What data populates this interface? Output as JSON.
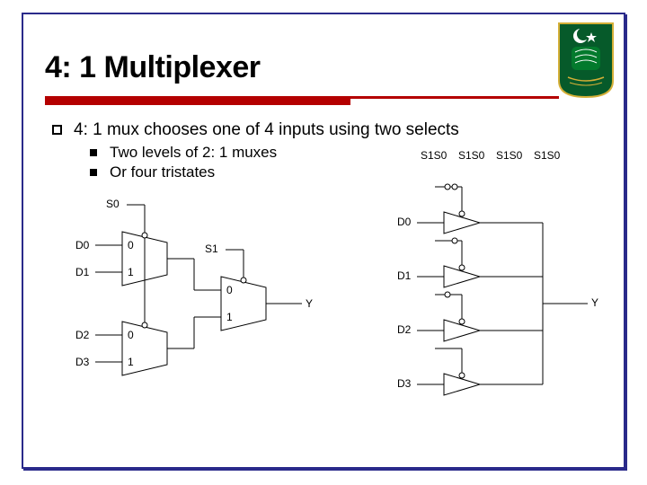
{
  "title": "4: 1 Multiplexer",
  "main_bullet": "4: 1 mux chooses one of 4 inputs using two selects",
  "sub_bullets": [
    "Two levels of 2: 1 muxes",
    "Or four tristates"
  ],
  "diagram_mux": {
    "s0": "S0",
    "s1": "S1",
    "d0": "D0",
    "d1": "D1",
    "d2": "D2",
    "d3": "D3",
    "y": "Y",
    "pin0": "0",
    "pin1": "1"
  },
  "diagram_tristate": {
    "sel0": "S1S0",
    "sel1": "S1S0",
    "sel2": "S1S0",
    "sel3": "S1S0",
    "d0": "D0",
    "d1": "D1",
    "d2": "D2",
    "d3": "D3",
    "y": "Y"
  },
  "logo": {
    "alt": "university-logo"
  }
}
